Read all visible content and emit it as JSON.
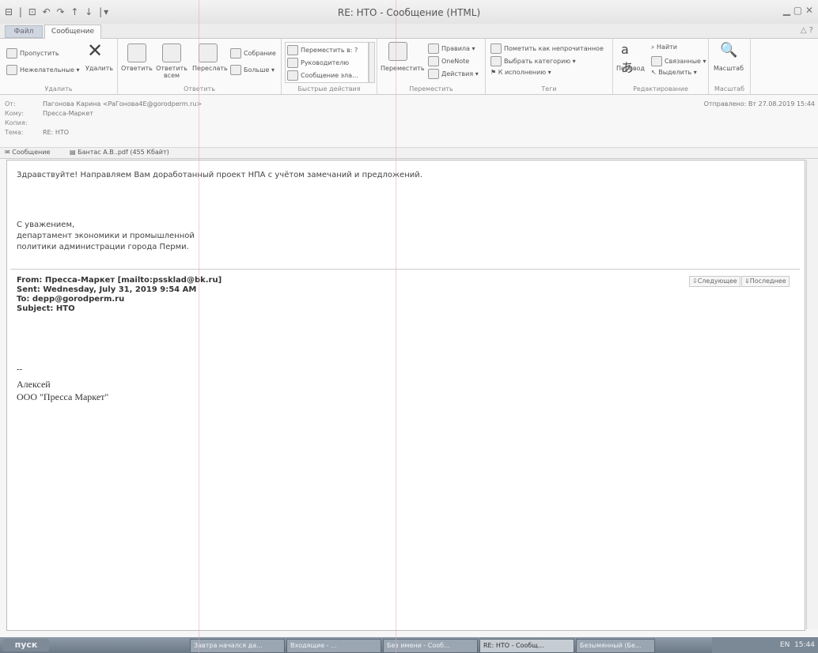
{
  "window": {
    "title": "RE: НТО  -  Сообщение (HTML)",
    "quick_access": "⊟ | ⊡ ↶ ↷ ↑ ↓ |▾"
  },
  "ribbon": {
    "tab_file": "Файл",
    "tab_message": "Сообщение",
    "groups": {
      "delete": {
        "label": "Удалить",
        "ignore": "Пропустить",
        "junk": "Нежелательные",
        "delete": "Удалить"
      },
      "respond": {
        "label": "Ответить",
        "reply": "Ответить",
        "reply_all": "Ответить всем",
        "forward": "Переслать",
        "meeting": "Собрание",
        "more": "Больше"
      },
      "quick_steps": {
        "label": "Быстрые действия",
        "items": [
          "Переместить в: ?",
          "Руководителю",
          "Сообщение эла..."
        ]
      },
      "move": {
        "label": "Переместить",
        "move": "Переместить",
        "rules": "Правила",
        "onenote": "OneNote",
        "actions": "Действия"
      },
      "tags": {
        "label": "Теги",
        "mark_unread": "Пометить как непрочитанное",
        "categorize": "Выбрать категорию",
        "followup": "К исполнению"
      },
      "editing": {
        "label": "Редактирование",
        "translate": "Перевод",
        "find": "Найти",
        "related": "Связанные",
        "select": "Выделить"
      },
      "zoom": {
        "label": "Масштаб",
        "zoom": "Масштаб"
      }
    }
  },
  "header": {
    "from_label": "От:",
    "from_value": "Пагонова Карина <PaГонова4E@gorodperm.ru>",
    "to_label": "Кому:",
    "to_value": "Пресса-Маркет",
    "cc_label": "Копия:",
    "subject_label": "Тема:",
    "subject_value": "RE: НТО",
    "sent_label": "Отправлено:",
    "sent_value": "Вт 27.08.2019 15:44"
  },
  "attachments": {
    "message_tab": "Сообщение",
    "file": "Бантас А.В..pdf (455 Кбайт)"
  },
  "body": {
    "greeting": "Здравствуйте! Направляем Вам доработанный проект НПА с учётом замечаний и предложений.",
    "regards": "С уважением,",
    "dept1": "департамент экономики и промышленной",
    "dept2": "политики администрации города Перми.",
    "quoted_from": "From: Пресса-Маркет [mailto:pssklad@bk.ru]",
    "quoted_sent": "Sent: Wednesday, July 31, 2019 9:54 AM",
    "quoted_to": "To: depp@gorodperm.ru",
    "quoted_subject": "Subject: НТО",
    "sig_dash": "--",
    "sig_name": "Алексей",
    "sig_company": "ООО \"Пресса Маркет\"",
    "next_btn": "Следующее",
    "last_btn": "Последнее"
  },
  "taskbar": {
    "start": "пуск",
    "items": [
      "Завтра начался да...",
      "Входящие - ...",
      "Без имени - Сооб...",
      "RE: НТО - Сообщ...",
      "Безымянный (Бе..."
    ],
    "lang": "EN",
    "time": "15:44"
  }
}
